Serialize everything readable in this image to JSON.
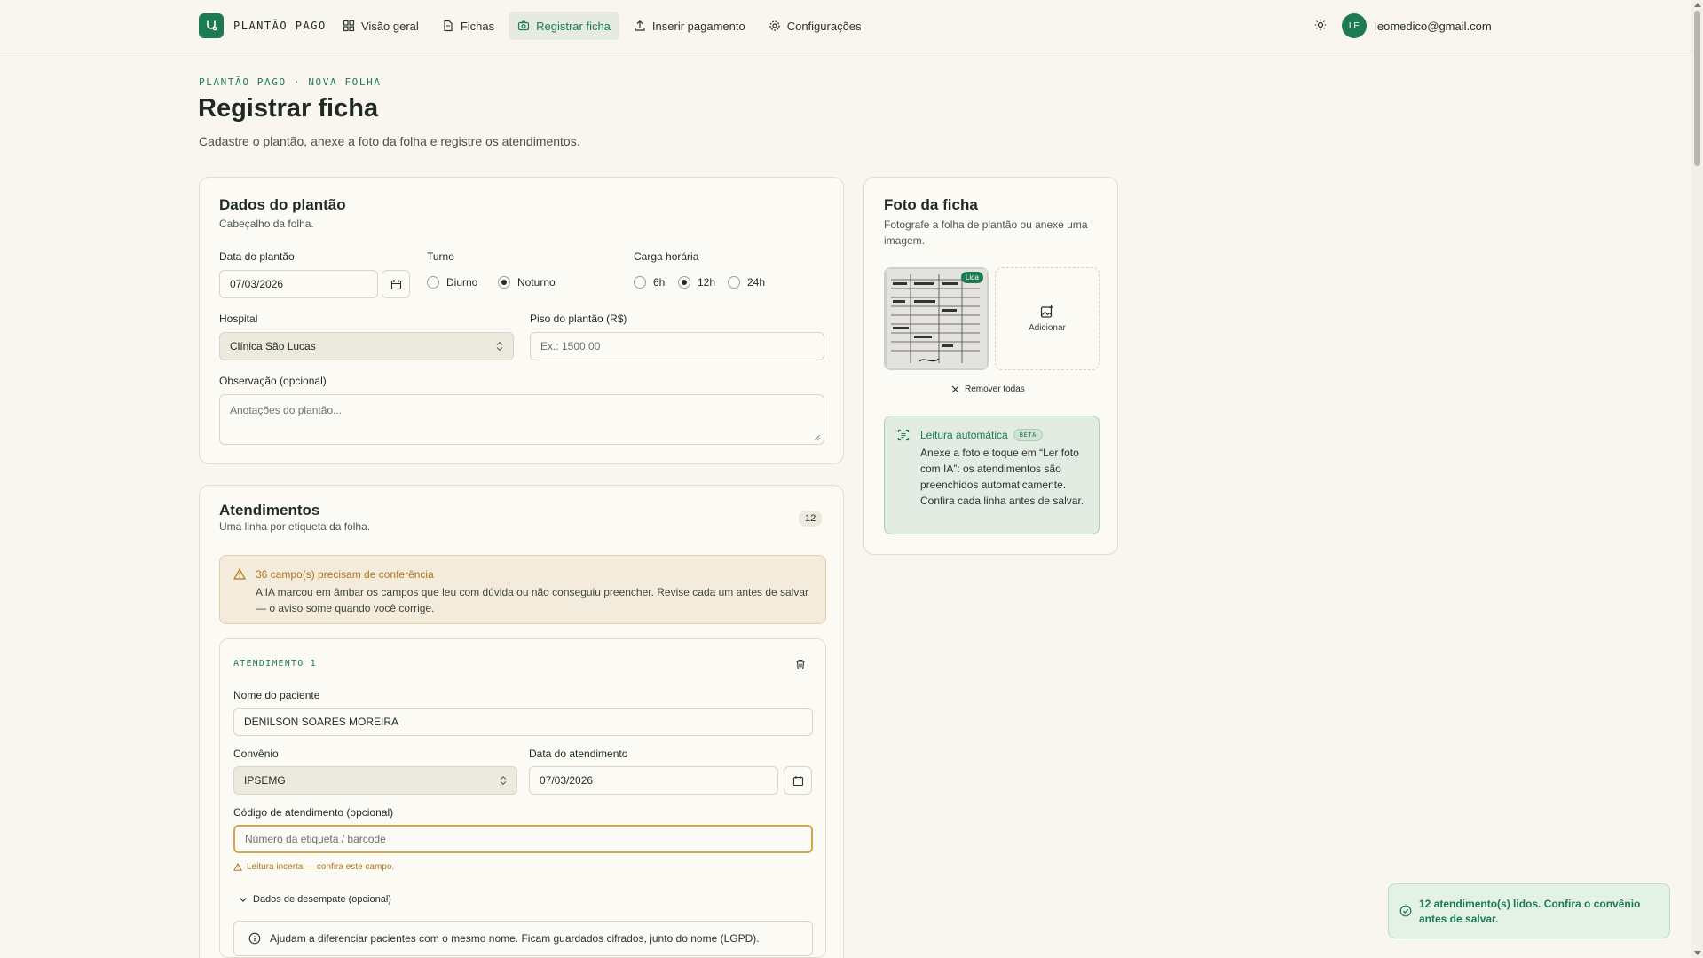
{
  "brand": {
    "name": "PLANTÃO PAGO"
  },
  "nav": [
    {
      "label": "Visão geral",
      "icon": "grid-icon"
    },
    {
      "label": "Fichas",
      "icon": "file-icon"
    },
    {
      "label": "Registrar ficha",
      "icon": "camera-icon",
      "active": true
    },
    {
      "label": "Inserir pagamento",
      "icon": "upload-icon"
    },
    {
      "label": "Configurações",
      "icon": "gear-icon"
    }
  ],
  "user": {
    "initials": "LE",
    "email": "leomedico@gmail.com"
  },
  "page": {
    "breadcrumb": "PLANTÃO PAGO · NOVA FOLHA",
    "title": "Registrar ficha",
    "subtitle": "Cadastre o plantão, anexe a foto da folha e registre os atendimentos."
  },
  "shift": {
    "title": "Dados do plantão",
    "subtitle": "Cabeçalho da folha.",
    "date_label": "Data do plantão",
    "date_value": "07/03/2026",
    "turn_label": "Turno",
    "turn_options": [
      "Diurno",
      "Noturno"
    ],
    "turn_selected": "Noturno",
    "hours_label": "Carga horária",
    "hours_options": [
      "6h",
      "12h",
      "24h"
    ],
    "hours_selected": "12h",
    "hospital_label": "Hospital",
    "hospital_value": "Clínica São Lucas",
    "floor_label": "Piso do plantão (R$)",
    "floor_placeholder": "Ex.: 1500,00",
    "note_label": "Observação (opcional)",
    "note_placeholder": "Anotações do plantão..."
  },
  "attendances": {
    "title": "Atendimentos",
    "subtitle": "Uma linha por etiqueta da folha.",
    "count": "12",
    "warning_title": "36 campo(s) precisam de conferência",
    "warning_text": "A IA marcou em âmbar os campos que leu com dúvida ou não conseguiu preencher. Revise cada um antes de salvar — o aviso some quando você corrige.",
    "item": {
      "tag": "ATENDIMENTO 1",
      "patient_label": "Nome do paciente",
      "patient_value": "DENILSON SOARES MOREIRA",
      "insurance_label": "Convênio",
      "insurance_value": "IPSEMG",
      "date_label": "Data do atendimento",
      "date_value": "07/03/2026",
      "code_label": "Código de atendimento (opcional)",
      "code_placeholder": "Número da etiqueta / barcode",
      "code_hint": "Leitura incerta — confira este campo.",
      "tiebreak_label": "Dados de desempate (opcional)",
      "tiebreak_info": "Ajudam a diferenciar pacientes com o mesmo nome. Ficam guardados cifrados, junto do nome (LGPD)."
    }
  },
  "photo": {
    "title": "Foto da ficha",
    "subtitle": "Fotografe a folha de plantão ou anexe uma imagem.",
    "thumb_badge": "Lida",
    "add_label": "Adicionar",
    "remove_all": "Remover todas",
    "ai_title": "Leitura automática",
    "ai_badge": "BETA",
    "ai_text": "Anexe a foto e toque em “Ler foto com IA”: os atendimentos são preenchidos automaticamente. Confira cada linha antes de salvar."
  },
  "toast": {
    "text": "12 atendimento(s) lidos. Confira o convênio antes de salvar."
  },
  "colors": {
    "accent": "#1e7a52",
    "warning": "#b3761c",
    "background": "#f8f6ef"
  }
}
